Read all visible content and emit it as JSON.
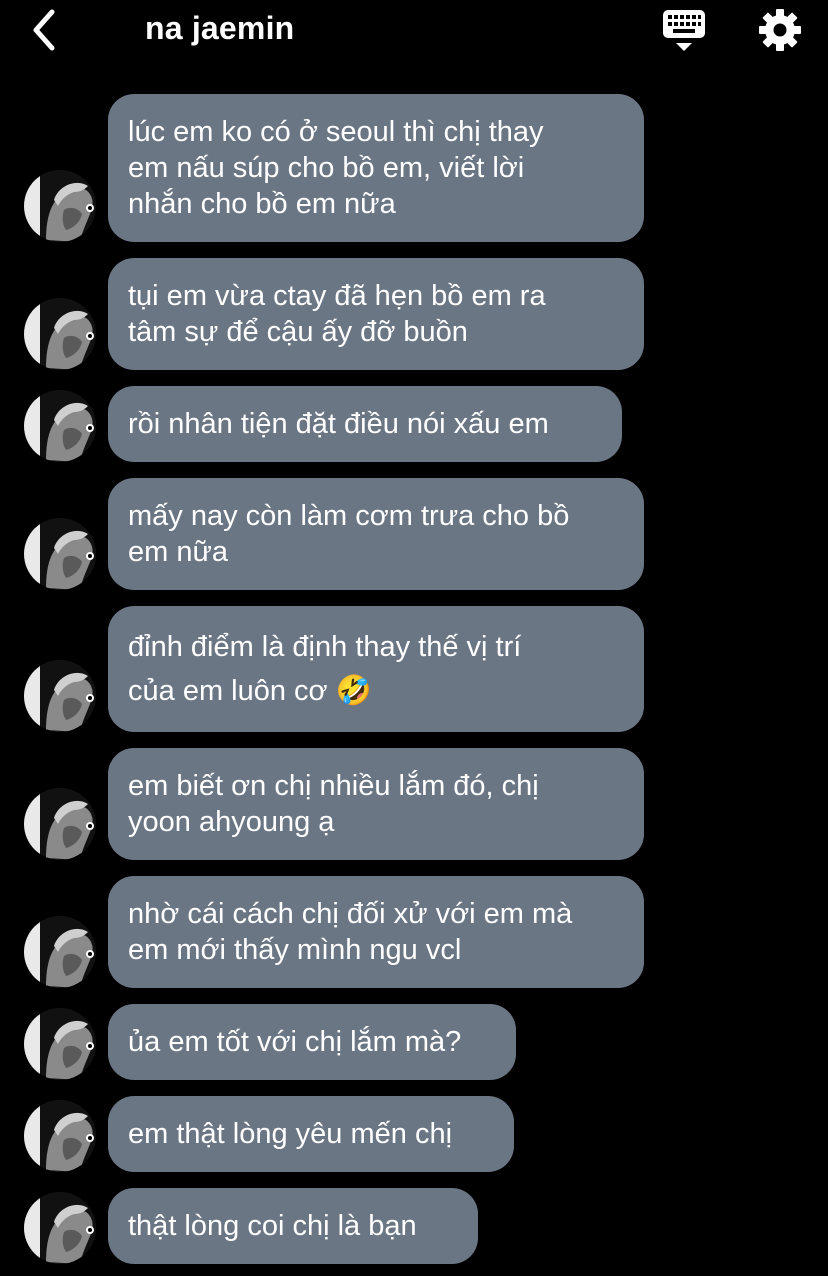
{
  "header": {
    "back_icon": "chevron-left-icon",
    "title": "na jaemin",
    "keyboard_icon": "keyboard-dismiss-icon",
    "settings_icon": "gear-icon"
  },
  "colors": {
    "background": "#000000",
    "bubble": "#6b7685",
    "text": "#ffffff"
  },
  "messages": [
    {
      "text": "lúc em ko có ở seoul thì chị thay\nem nấu súp cho bồ em, viết lời\nnhắn cho bồ em nữa"
    },
    {
      "text": "tụi em vừa ctay đã hẹn bồ em ra\ntâm sự để cậu ấy đỡ buồn"
    },
    {
      "text": "rồi nhân tiện đặt điều nói xấu em"
    },
    {
      "text": "mấy nay còn làm cơm trưa cho bồ\nem nữa"
    },
    {
      "text": "đỉnh điểm là định thay thế vị trí\ncủa em luôn cơ 🤣"
    },
    {
      "text": "em biết ơn chị nhiều lắm đó, chị\nyoon ahyoung ạ"
    },
    {
      "text": "nhờ cái cách chị đối xử với em mà\nem mới thấy mình ngu vcl"
    },
    {
      "text": "ủa em tốt với chị lắm mà?"
    },
    {
      "text": "em thật lòng yêu mến chị"
    },
    {
      "text": "thật lòng coi chị là bạn"
    }
  ]
}
